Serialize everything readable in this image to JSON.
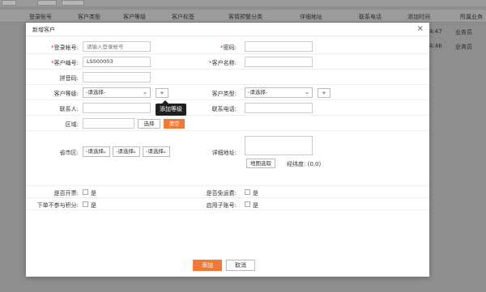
{
  "background": {
    "toolbar_buttons": [
      "",
      "",
      ""
    ],
    "columns": [
      "登录账号",
      "客户类型",
      "客户等级",
      "客户标签",
      "客情预警分类",
      "详细地址",
      "联系电话",
      "添加时间",
      "所属业务"
    ],
    "rows": [
      {
        "time": "4:47",
        "owner": "业务员"
      },
      {
        "time": "4:46",
        "owner": "业务员"
      }
    ]
  },
  "dialog": {
    "title": "新增客户",
    "close_glyph": "×",
    "fields": {
      "login": {
        "label": "登录帐号:",
        "placeholder": "请输入登录帐号"
      },
      "password": {
        "label": "密码:",
        "value": ""
      },
      "code": {
        "label": "客户编号:",
        "value": "LSS00003"
      },
      "name": {
        "label": "客户名称:",
        "value": ""
      },
      "pinyin": {
        "label": "拼音码:",
        "value": ""
      },
      "level": {
        "label": "客户等级:",
        "selected": "-请选择-",
        "add_button": "+"
      },
      "type": {
        "label": "客户类型:",
        "selected": "-请选择-",
        "add_button": "+"
      },
      "contact": {
        "label": "联系人:",
        "value": ""
      },
      "phone": {
        "label": "联系电话:",
        "value": ""
      },
      "region": {
        "label": "区域:",
        "select_button": "选择",
        "clear_button": "清空"
      },
      "province": {
        "label": "省市区:",
        "selects": [
          "-请选择",
          "-请选择",
          "-请选择"
        ]
      },
      "address": {
        "label": "详细地址:",
        "map_button": "地图选取",
        "coords_label": "经纬度:",
        "coords_value": "(0,0)"
      },
      "invoice": {
        "label": "是否开票:",
        "option": "是"
      },
      "free_shipping": {
        "label": "是否免运费:",
        "option": "是"
      },
      "no_points": {
        "label": "下单不参与积分:",
        "option": "是"
      },
      "sub_account": {
        "label": "启用子账号:",
        "option": "是"
      }
    },
    "tooltip": "添加等级",
    "footer": {
      "add": "添加",
      "cancel": "取消"
    }
  }
}
